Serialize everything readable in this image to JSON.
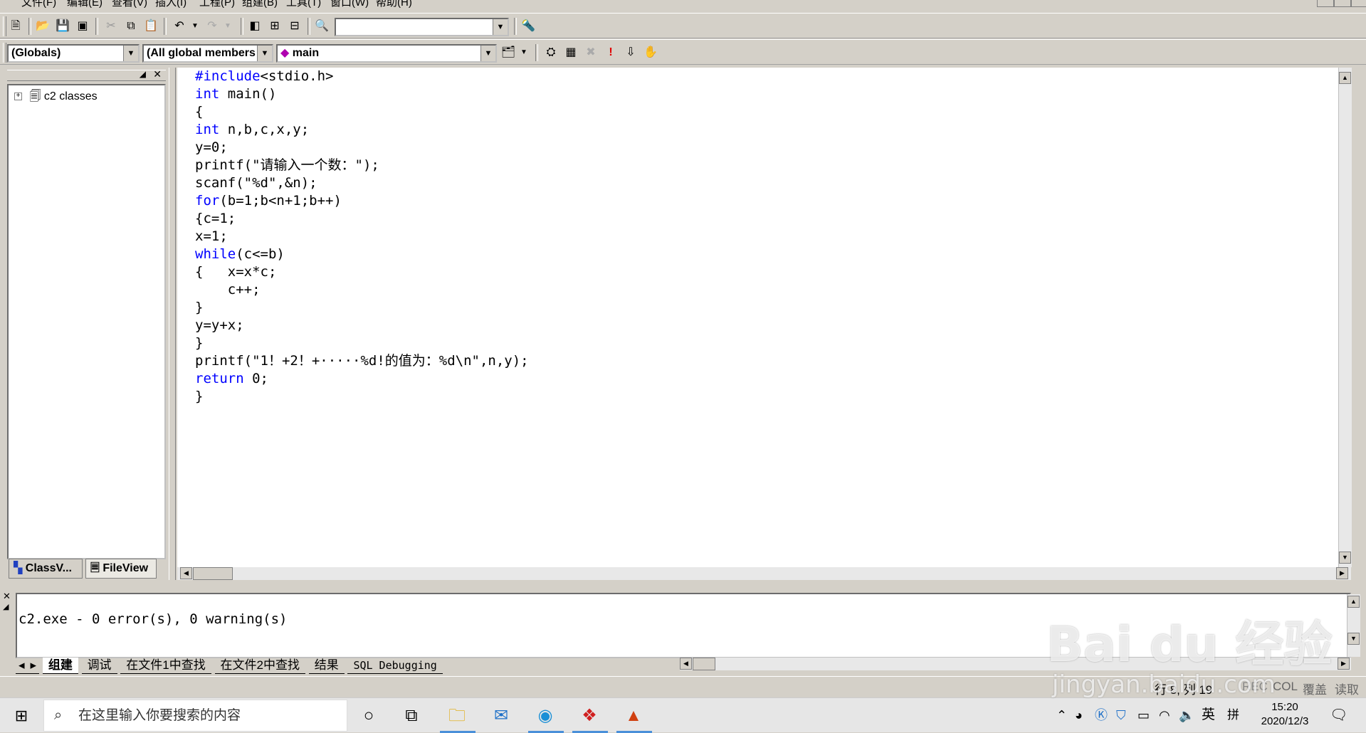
{
  "menu": [
    "文件(F)",
    "编辑(E)",
    "查看(V)",
    "插入(I)",
    "工程(P)",
    "组建(B)",
    "工具(T)",
    "窗口(W)",
    "帮助(H)"
  ],
  "toolbar": {
    "find_combo_value": ""
  },
  "wizardbar": {
    "class_combo": "(Globals)",
    "filter_combo": "(All global members",
    "member_combo": "main"
  },
  "workspace": {
    "tree_root": "c2 classes",
    "tabs": [
      "ClassV...",
      "FileView"
    ]
  },
  "editor": {
    "lines": [
      [
        {
          "t": "#include",
          "k": true
        },
        {
          "t": "<stdio.h>",
          "k": false
        }
      ],
      [
        {
          "t": "int",
          "k": true
        },
        {
          "t": " main()",
          "k": false
        }
      ],
      [
        {
          "t": "{",
          "k": false
        }
      ],
      [
        {
          "t": "int",
          "k": true
        },
        {
          "t": " n,b,c,x,y;",
          "k": false
        }
      ],
      [
        {
          "t": "y=0;",
          "k": false
        }
      ],
      [
        {
          "t": "printf(\"请输入一个数：\");",
          "k": false
        }
      ],
      [
        {
          "t": "scanf(\"%d\",&n);",
          "k": false
        }
      ],
      [
        {
          "t": "for",
          "k": true
        },
        {
          "t": "(b=1;b<n+1;b++)",
          "k": false
        }
      ],
      [
        {
          "t": "{c=1;",
          "k": false
        }
      ],
      [
        {
          "t": "x=1;",
          "k": false
        }
      ],
      [
        {
          "t": "while",
          "k": true
        },
        {
          "t": "(c<=b)",
          "k": false
        }
      ],
      [
        {
          "t": "{   x=x*c;",
          "k": false
        }
      ],
      [
        {
          "t": "    c++;",
          "k": false
        }
      ],
      [
        {
          "t": "}",
          "k": false
        }
      ],
      [
        {
          "t": "y=y+x;",
          "k": false
        }
      ],
      [
        {
          "t": "}",
          "k": false
        }
      ],
      [
        {
          "t": "printf(\"1！+2！+·····%d!的值为：%d\\n\",n,y);",
          "k": false
        }
      ],
      [
        {
          "t": "return",
          "k": true
        },
        {
          "t": " 0;",
          "k": false
        }
      ],
      [
        {
          "t": "}",
          "k": false
        }
      ]
    ]
  },
  "output": {
    "text": "c2.exe - 0 error(s), 0 warning(s)",
    "tabs": [
      "组建",
      "调试",
      "在文件1中查找",
      "在文件2中查找",
      "结果",
      "SQL Debugging"
    ]
  },
  "status": {
    "position": "行 8, 列 19",
    "rec": "REC",
    "col": "COL",
    "ovr": "覆盖",
    "read": "读取"
  },
  "taskbar": {
    "search_placeholder": "在这里输入你要搜索的内容",
    "ime_lang": "英",
    "ime_mode": "拼",
    "time": "15:20",
    "date": "2020/12/3"
  },
  "watermark": {
    "logo": "Bai du 经验",
    "url": "jingyan.baidu.com"
  },
  "colors": {
    "keyword": "#0000ff",
    "face": "#d4d0c8"
  }
}
